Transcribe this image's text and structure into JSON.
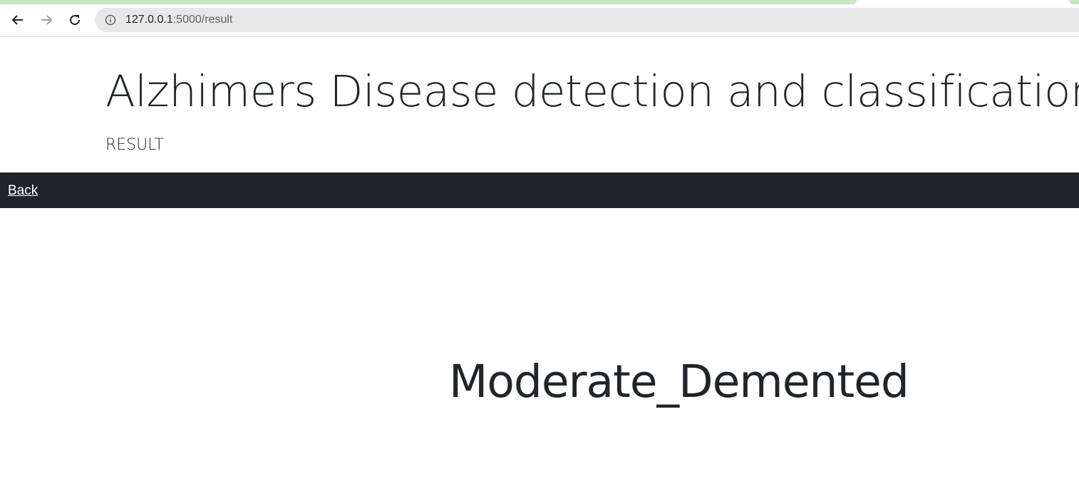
{
  "browser": {
    "url_host": "127.0.0.1",
    "url_rest": ":5000/result",
    "back_icon": "arrow-left-icon",
    "forward_icon": "arrow-right-icon",
    "reload_icon": "reload-icon",
    "info_icon": "info-icon",
    "tab_accent_color": "#c8e6c0"
  },
  "header": {
    "title": "Alzhimers Disease detection and classification",
    "subtitle": "RESULT"
  },
  "navbar": {
    "back_label": "Back",
    "background_color": "#212529"
  },
  "main": {
    "result": "Moderate_Demented"
  }
}
